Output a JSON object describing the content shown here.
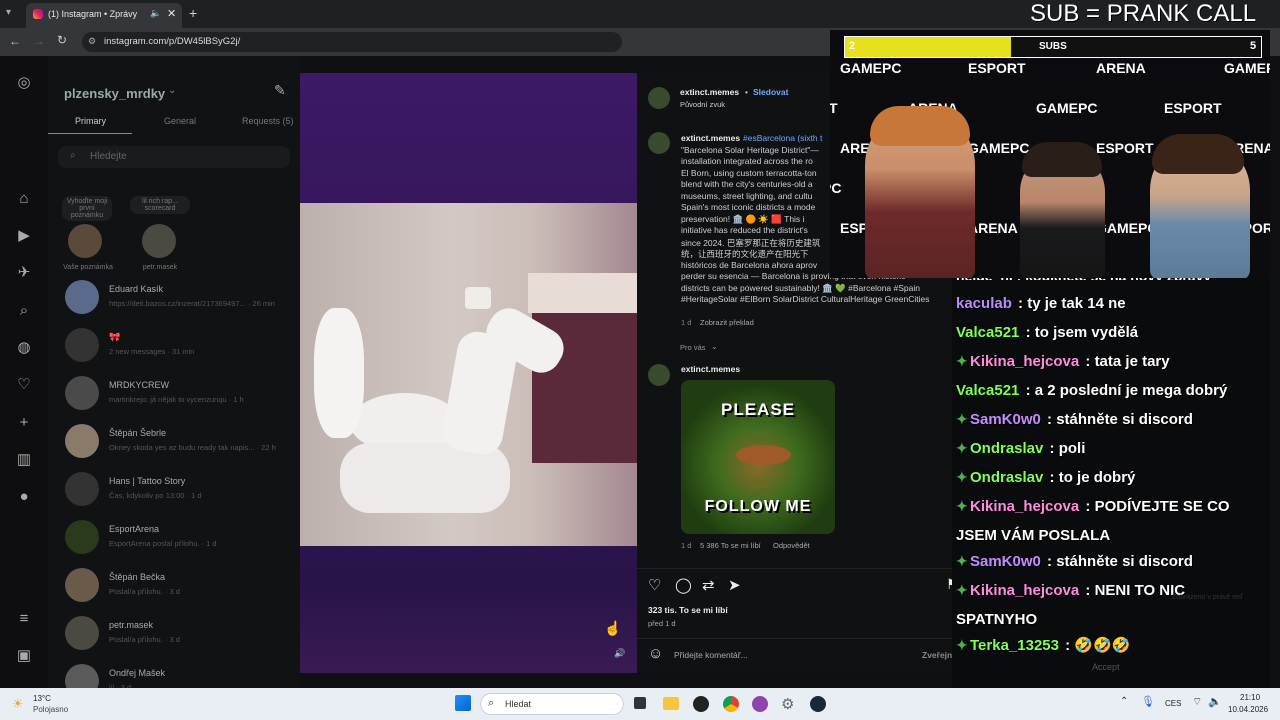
{
  "browser": {
    "tab_title": "(1) Instagram • Zprávy",
    "url": "instagram.com/p/DW45lBSyG2j/"
  },
  "overlay": {
    "text": "SUB = PRANK CALL"
  },
  "dm": {
    "username": "plzensky_mrdky",
    "tabs": [
      "Primary",
      "General",
      "Requests (5)"
    ],
    "search_placeholder": "Hledejte",
    "notes": [
      {
        "bubble": "Vyhoďte moji první poznámku",
        "name": "Vaše poznámka"
      },
      {
        "bubble": "lil rich rap... scorecard",
        "name": "petr.masek"
      }
    ],
    "rows": [
      {
        "name": "Eduard Kasík",
        "msg": "https://deti.bazos.cz/inzerat/217369497... · 26 min"
      },
      {
        "name": "🎀",
        "msg": "2 new messages · 31 min"
      },
      {
        "name": "MRDKYCREW",
        "msg": "martinkrejo: já nějak to vycenzuruju · 1 h"
      },
      {
        "name": "Štěpán Šebrle",
        "msg": "Okney skoda yes az budu ready tak napis... · 22 h"
      },
      {
        "name": "Hans | Tattoo Story",
        "msg": "Čas, kdykoliv po 13:00 · 1 d"
      },
      {
        "name": "EsportArena",
        "msg": "EsportArena poslal přílohu. · 1 d"
      },
      {
        "name": "Štěpán Bečka",
        "msg": "Poslal/a přílohu. · 3 d"
      },
      {
        "name": "petr.masek",
        "msg": "Poslal/a přílohu. · 3 d"
      },
      {
        "name": "Ondřej Mašek",
        "msg": "lil · 3 d"
      }
    ]
  },
  "post": {
    "author": "extinct.memes",
    "follow": "Sledovat",
    "audio": "Původní zvuk",
    "caption_lines": [
      "#esBarcelona (sixth t",
      "\"Barcelona Solar Heritage District\"—",
      "installation integrated across the ro",
      "El Born, using custom terracotta-ton",
      "blend with the city's centuries-old a",
      "museums, street lighting, and cultu",
      "Spain's most iconic districts a mode",
      "preservation! 🏛️ 🟠 ☀️ 🟥 This i",
      "initiative has reduced the district's",
      "since 2024. 巴塞罗那正在将历史建筑",
      "统，让西班牙的文化遗产在阳光下",
      "históricos de Barcelona ahora aprov",
      "perder su esencia — Barcelona is proving that even historic",
      "districts can be powered sustainably! 🏛️ 💚 #Barcelona #Spain",
      "#HeritageSolar #ElBorn SolarDistrict CulturalHeritage GreenCities"
    ],
    "caption_time": "1 d",
    "translate": "Zobrazit překlad",
    "for_you": "Pro vás",
    "comment_author": "extinct.memes",
    "gif_top": "PLEASE",
    "gif_bottom": "FOLLOW ME",
    "comment_time": "1 d",
    "comment_likes": "5 386 To se mi líbí",
    "reply": "Odpovědět",
    "likes": "323 tis. To se mi líbí",
    "ago": "před 1 d",
    "comment_placeholder": "Přidejte komentář...",
    "publish": "Zveřejnit"
  },
  "stream": {
    "subs_left": "2",
    "subs_label": "SUBS",
    "subs_right": "5",
    "subs_fill": 0.4,
    "banner_words": [
      "GAMEPC",
      "ESPORT",
      "ARENA"
    ]
  },
  "chat": [
    {
      "user": "kaculab",
      "color": "#b98cff",
      "diamond": false,
      "text": "ty je tak 14 ne"
    },
    {
      "user": "Valca521",
      "color": "#7fff5a",
      "diamond": false,
      "text": "to jsem vydělá"
    },
    {
      "user": "Kikina_hejcova",
      "color": "#ff8ce0",
      "diamond": true,
      "text": "tata je tary"
    },
    {
      "user": "Valca521",
      "color": "#7fff5a",
      "diamond": false,
      "text": "a 2 poslední je mega dobrý"
    },
    {
      "user": "SamK0w0",
      "color": "#c58cff",
      "diamond": true,
      "text": "stáhněte si discord"
    },
    {
      "user": "Ondraslav",
      "color": "#7fff5a",
      "diamond": true,
      "text": "poli"
    },
    {
      "user": "Ondraslav",
      "color": "#7fff5a",
      "diamond": true,
      "text": "to je dobrý"
    },
    {
      "user": "Kikina_hejcova",
      "color": "#ff8ce0",
      "diamond": true,
      "text": "PODÍVEJTE SE CO"
    },
    {
      "user": "",
      "color": "#fff",
      "diamond": false,
      "text": "JSEM VÁM POSLALA"
    },
    {
      "user": "SamK0w0",
      "color": "#c58cff",
      "diamond": true,
      "text": "stáhněte si discord"
    },
    {
      "user": "Kikina_hejcova",
      "color": "#ff8ce0",
      "diamond": true,
      "text": "NENI TO NIC"
    },
    {
      "user": "",
      "color": "#fff",
      "diamond": false,
      "text": "SPATNYHO"
    },
    {
      "user": "Terka_13253",
      "color": "#7fff5a",
      "diamond": true,
      "text": "🤣🤣🤣"
    }
  ],
  "chat_top_partial": "ňejde_ni : koukněte se na nový zprávy",
  "accept": "Accept",
  "seen": "Zobrazeno v právě teď",
  "taskbar": {
    "temp": "13°C",
    "weather": "Polojasno",
    "search": "Hledat",
    "lang": "CES",
    "time": "21:10",
    "date": "10.04.2026"
  }
}
